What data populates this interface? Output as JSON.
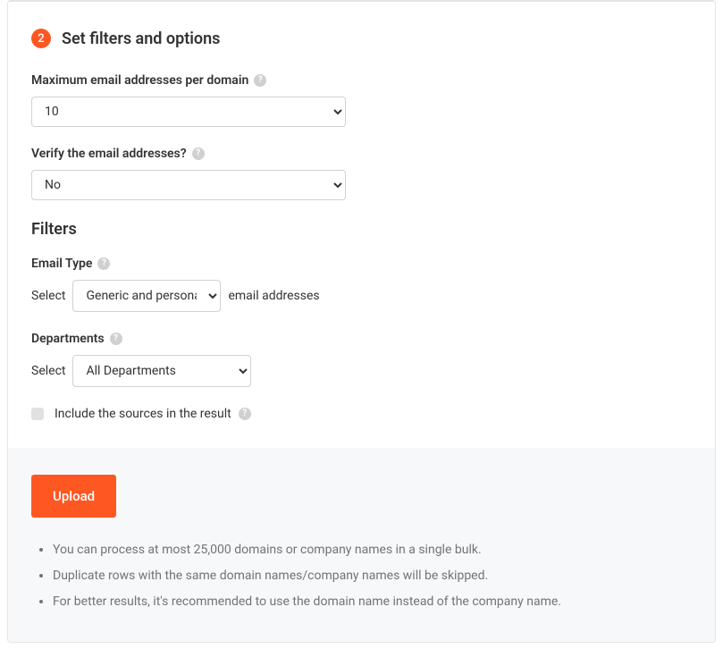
{
  "step": {
    "number": "2",
    "title": "Set filters and options"
  },
  "form": {
    "max_emails": {
      "label": "Maximum email addresses per domain",
      "value": "10"
    },
    "verify": {
      "label": "Verify the email addresses?",
      "value": "No"
    }
  },
  "filters": {
    "heading": "Filters",
    "email_type": {
      "label": "Email Type",
      "prefix": "Select",
      "value": "Generic and personal",
      "suffix": "email addresses"
    },
    "departments": {
      "label": "Departments",
      "prefix": "Select",
      "value": "All Departments"
    },
    "include_sources": {
      "label": "Include the sources in the result"
    }
  },
  "footer": {
    "upload_label": "Upload",
    "notes": [
      "You can process at most 25,000 domains or company names in a single bulk.",
      "Duplicate rows with the same domain names/company names will be skipped.",
      "For better results, it's recommended to use the domain name instead of the company name."
    ]
  },
  "help_glyph": "?"
}
